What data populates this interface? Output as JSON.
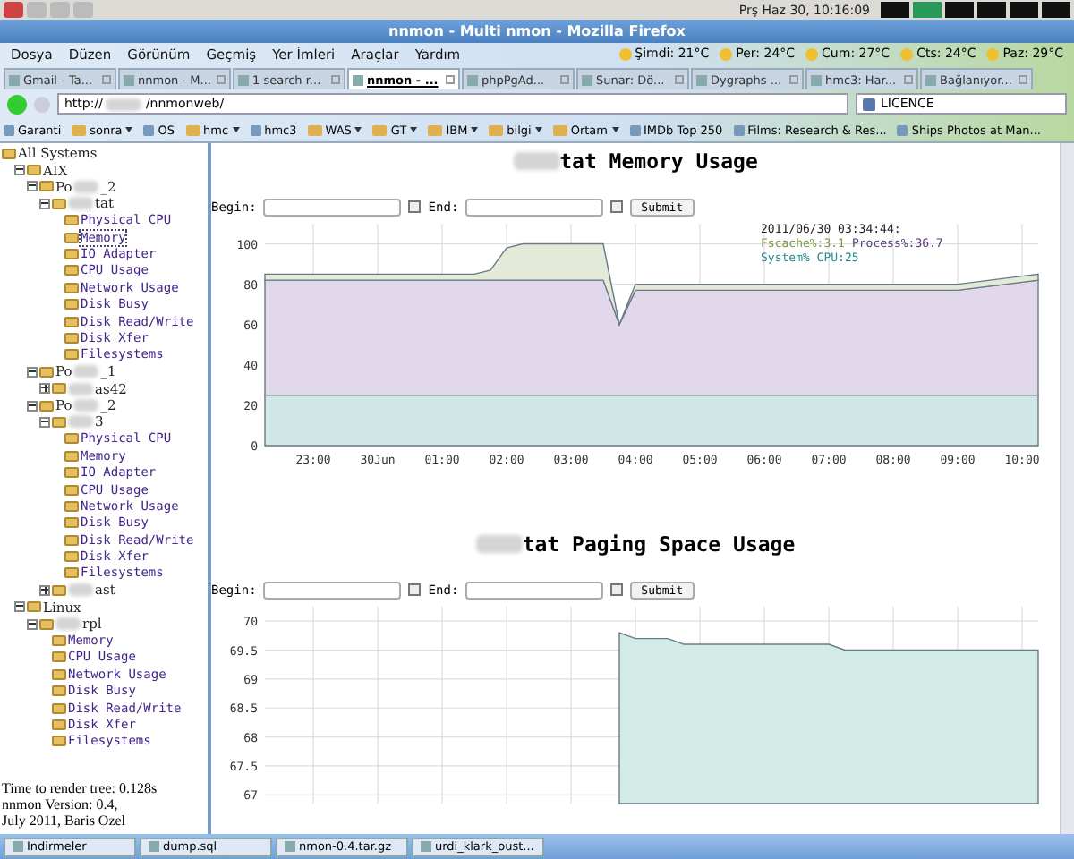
{
  "top_panel": {
    "clock": "Prş Haz 30, 10:16:09"
  },
  "window": {
    "title": "nnmon - Multi nmon - Mozilla Firefox"
  },
  "menu": [
    "Dosya",
    "Düzen",
    "Görünüm",
    "Geçmiş",
    "Yer İmleri",
    "Araçlar",
    "Yardım"
  ],
  "weather": [
    "Şimdi: 21°C",
    "Per: 24°C",
    "Cum: 27°C",
    "Cts: 24°C",
    "Paz: 29°C"
  ],
  "tabs": [
    {
      "label": "Gmail - Ta...",
      "selected": false
    },
    {
      "label": "nnmon - M...",
      "selected": false
    },
    {
      "label": "1 search r...",
      "selected": false
    },
    {
      "label": "nnmon - ...",
      "selected": true
    },
    {
      "label": "phpPgAd...",
      "selected": false
    },
    {
      "label": "Sunar: Dö...",
      "selected": false
    },
    {
      "label": "Dygraphs ...",
      "selected": false
    },
    {
      "label": "hmc3: Har...",
      "selected": false
    },
    {
      "label": "Bağlanıyor...",
      "selected": false
    }
  ],
  "address": {
    "start": "http://",
    "end": "/nnmonweb/"
  },
  "search": {
    "value": "LICENCE"
  },
  "bookmarks": [
    {
      "label": "Garanti",
      "kind": "link"
    },
    {
      "label": "sonra",
      "kind": "folder"
    },
    {
      "label": "OS",
      "kind": "link"
    },
    {
      "label": "hmc",
      "kind": "folder"
    },
    {
      "label": "hmc3",
      "kind": "link"
    },
    {
      "label": "WAS",
      "kind": "folder"
    },
    {
      "label": "GT",
      "kind": "folder"
    },
    {
      "label": "IBM",
      "kind": "folder"
    },
    {
      "label": "bilgi",
      "kind": "folder"
    },
    {
      "label": "Ortam",
      "kind": "folder"
    },
    {
      "label": "IMDb Top 250",
      "kind": "link"
    },
    {
      "label": "Films: Research & Res...",
      "kind": "link"
    },
    {
      "label": "Ships Photos at Man...",
      "kind": "link"
    }
  ],
  "sidebar": {
    "tree": [
      {
        "kind": "group",
        "label": "All Systems",
        "children": [
          {
            "kind": "group",
            "label": "AIX",
            "expanded": true,
            "children": [
              {
                "kind": "group",
                "label": "Po",
                "label_end": "_2",
                "redacted": true,
                "expanded": true,
                "children": [
                  {
                    "kind": "group",
                    "label_end": "tat",
                    "redacted": true,
                    "expanded": true,
                    "children": [
                      {
                        "kind": "page",
                        "label": "Physical CPU",
                        "selected": false
                      },
                      {
                        "kind": "page",
                        "label": "Memory",
                        "selected": true
                      },
                      {
                        "kind": "page",
                        "label": "IO Adapter",
                        "selected": false
                      },
                      {
                        "kind": "page",
                        "label": "CPU Usage",
                        "selected": false
                      },
                      {
                        "kind": "page",
                        "label": "Network Usage",
                        "selected": false
                      },
                      {
                        "kind": "page",
                        "label": "Disk Busy",
                        "selected": false
                      },
                      {
                        "kind": "page",
                        "label": "Disk Read/Write",
                        "selected": false
                      },
                      {
                        "kind": "page",
                        "label": "Disk Xfer",
                        "selected": false
                      },
                      {
                        "kind": "page",
                        "label": "Filesystems",
                        "selected": false
                      }
                    ]
                  }
                ]
              },
              {
                "kind": "group",
                "label": "Po",
                "label_end": "_1",
                "redacted": true,
                "expanded": true,
                "children": [
                  {
                    "kind": "group",
                    "label_end": "as42",
                    "redacted": true,
                    "expanded": false
                  }
                ]
              },
              {
                "kind": "group",
                "label": "Po",
                "label_end": "_2",
                "redacted": true,
                "expanded": true,
                "children": [
                  {
                    "kind": "group",
                    "label_end": "3",
                    "redacted": true,
                    "expanded": true,
                    "children": [
                      {
                        "kind": "page",
                        "label": "Physical CPU",
                        "selected": false
                      },
                      {
                        "kind": "page",
                        "label": "Memory",
                        "selected": false
                      },
                      {
                        "kind": "page",
                        "label": "IO Adapter",
                        "selected": false
                      },
                      {
                        "kind": "page",
                        "label": "CPU Usage",
                        "selected": false
                      },
                      {
                        "kind": "page",
                        "label": "Network Usage",
                        "selected": false
                      },
                      {
                        "kind": "page",
                        "label": "Disk Busy",
                        "selected": false
                      },
                      {
                        "kind": "page",
                        "label": "Disk Read/Write",
                        "selected": false
                      },
                      {
                        "kind": "page",
                        "label": "Disk Xfer",
                        "selected": false
                      },
                      {
                        "kind": "page",
                        "label": "Filesystems",
                        "selected": false
                      }
                    ]
                  },
                  {
                    "kind": "group",
                    "label_end": "ast",
                    "redacted": true,
                    "expanded": false
                  }
                ]
              }
            ]
          },
          {
            "kind": "group",
            "label": "Linux",
            "expanded": true,
            "children": [
              {
                "kind": "group",
                "label_end": "rpl",
                "redacted": true,
                "expanded": true,
                "children": [
                  {
                    "kind": "page",
                    "label": "Memory",
                    "selected": false
                  },
                  {
                    "kind": "page",
                    "label": "CPU Usage",
                    "selected": false
                  },
                  {
                    "kind": "page",
                    "label": "Network Usage",
                    "selected": false
                  },
                  {
                    "kind": "page",
                    "label": "Disk Busy",
                    "selected": false
                  },
                  {
                    "kind": "page",
                    "label": "Disk Read/Write",
                    "selected": false
                  },
                  {
                    "kind": "page",
                    "label": "Disk Xfer",
                    "selected": false
                  },
                  {
                    "kind": "page",
                    "label": "Filesystems",
                    "selected": false
                  }
                ]
              }
            ]
          }
        ]
      }
    ],
    "footer": [
      "Time to render tree: 0.128s",
      "nnmon Version: 0.4,",
      "July 2011, Baris Ozel"
    ]
  },
  "panels": [
    {
      "title": "tat Memory Usage",
      "redacted_prefix": true,
      "form": {
        "begin_label": "Begin:",
        "end_label": "End:",
        "submit": "Submit"
      },
      "legend": {
        "time": "2011/06/30 03:34:44:",
        "items": [
          {
            "text": "Fscache%:3.1",
            "color": "#7a9a4a"
          },
          {
            "text": "Process%:36.7",
            "color": "#5a3a7a"
          },
          {
            "text": "System% CPU:25",
            "color": "#2a8a8a"
          }
        ]
      },
      "chart_data": {
        "type": "area",
        "stacked": true,
        "grid": true,
        "ylim": [
          0,
          110
        ],
        "categories": [
          null,
          null,
          null,
          "23:00",
          null,
          null,
          null,
          "30Jun",
          null,
          null,
          null,
          "01:00",
          null,
          null,
          null,
          "02:00",
          null,
          null,
          null,
          "03:00",
          null,
          null,
          null,
          "04:00",
          null,
          null,
          null,
          "05:00",
          null,
          null,
          null,
          "06:00",
          null,
          null,
          null,
          "07:00",
          null,
          null,
          null,
          "08:00",
          null,
          null,
          null,
          "09:00",
          null,
          null,
          null,
          "10:00",
          null
        ],
        "series": [
          {
            "color": "#cfe8e6",
            "values": [
              25,
              25,
              25,
              25,
              25,
              25,
              25,
              25,
              25,
              25,
              25,
              25,
              25,
              25,
              25,
              25,
              25,
              25,
              25,
              25,
              25,
              25,
              25,
              25,
              25,
              25,
              25,
              25,
              25,
              25,
              25,
              25,
              25,
              25,
              25,
              25,
              25,
              25,
              25,
              25,
              25,
              25,
              25,
              25,
              25,
              25,
              25,
              25,
              25
            ]
          },
          {
            "color": "#e2d8ec",
            "values": [
              57,
              57,
              57,
              57,
              57,
              57,
              57,
              57,
              57,
              57,
              57,
              57,
              57,
              57,
              57,
              57,
              57,
              57,
              57,
              57,
              57,
              57,
              35,
              52,
              52,
              52,
              52,
              52,
              52,
              52,
              52,
              52,
              52,
              52,
              52,
              52,
              52,
              52,
              52,
              52,
              52,
              52,
              52,
              52,
              53,
              54,
              55,
              56,
              57
            ]
          },
          {
            "color": "#e4ead8",
            "values": [
              3,
              3,
              3,
              3,
              3,
              3,
              3,
              3,
              3,
              3,
              3,
              3,
              3,
              3,
              5,
              16,
              18,
              18,
              18,
              18,
              18,
              18,
              0,
              3,
              3,
              3,
              3,
              3,
              3,
              3,
              3,
              3,
              3,
              3,
              3,
              3,
              3,
              3,
              3,
              3,
              3,
              3,
              3,
              3,
              3,
              3,
              3,
              3,
              3
            ]
          }
        ],
        "yticks": [
          0,
          20,
          40,
          60,
          80,
          100
        ]
      }
    },
    {
      "title": "tat Paging Space Usage",
      "redacted_prefix": true,
      "form": {
        "begin_label": "Begin:",
        "end_label": "End:",
        "submit": "Submit"
      },
      "chart_data": {
        "type": "area",
        "grid": true,
        "ylim": [
          66.85,
          70.25
        ],
        "categories": [
          null,
          null,
          null,
          null,
          null,
          null,
          null,
          null,
          null,
          null,
          null,
          null,
          null,
          null,
          null,
          null,
          null,
          null,
          null,
          null,
          null,
          null,
          null,
          null,
          null,
          null,
          null,
          null,
          null,
          null,
          null,
          null,
          null,
          null,
          null,
          null,
          null,
          null,
          null,
          null,
          null,
          null,
          null,
          null,
          null,
          null,
          null,
          null,
          null
        ],
        "series": [
          {
            "color": "#d3ebe6",
            "values": [
              null,
              null,
              null,
              null,
              null,
              null,
              null,
              null,
              null,
              null,
              null,
              null,
              null,
              null,
              null,
              null,
              null,
              null,
              null,
              null,
              null,
              null,
              69.8,
              69.7,
              69.7,
              69.7,
              69.6,
              69.6,
              69.6,
              69.6,
              69.6,
              69.6,
              69.6,
              69.6,
              69.6,
              69.6,
              69.5,
              69.5,
              69.5,
              69.5,
              69.5,
              69.5,
              69.5,
              69.5,
              69.5,
              69.5,
              69.5,
              69.5,
              69.5
            ]
          }
        ],
        "yticks": [
          67,
          67.5,
          68,
          68.5,
          69,
          69.5,
          70
        ]
      }
    }
  ],
  "taskbar": [
    "Indirmeler",
    "dump.sql",
    "nmon-0.4.tar.gz",
    "urdi_klark_oust..."
  ]
}
